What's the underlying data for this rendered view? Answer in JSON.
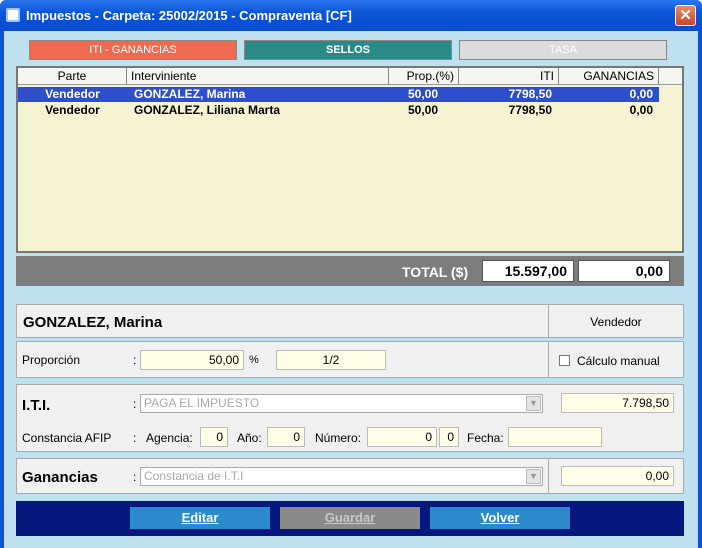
{
  "window": {
    "title": "Impuestos - Carpeta: 25002/2015 - Compraventa [CF]",
    "close_glyph": "✕"
  },
  "tabs": [
    {
      "label": "ITI - GANANCIAS",
      "color": "#f06a50"
    },
    {
      "label": "SELLOS",
      "color": "#2a8b86"
    },
    {
      "label": "TASA",
      "color": "#dcdcdc"
    }
  ],
  "grid": {
    "columns": [
      "Parte",
      "Interviniente",
      "Prop.(%)",
      "ITI",
      "GANANCIAS"
    ],
    "rows": [
      {
        "parte": "Vendedor",
        "interviniente": "GONZALEZ, Marina",
        "prop": "50,00",
        "iti": "7798,50",
        "ganancias": "0,00",
        "selected": true
      },
      {
        "parte": "Vendedor",
        "interviniente": "GONZALEZ, Liliana Marta",
        "prop": "50,00",
        "iti": "7798,50",
        "ganancias": "0,00",
        "selected": false
      }
    ]
  },
  "total": {
    "label": "TOTAL ($)",
    "iti": "15.597,00",
    "ganancias": "0,00"
  },
  "detail": {
    "name": "GONZALEZ, Marina",
    "role": "Vendedor",
    "proporcion_label": "Proporción",
    "colon": ":",
    "proporcion_value": "50,00",
    "percent_sign": "%",
    "fraction": "1/2",
    "manual_label": "Cálculo manual",
    "iti_label": "I.T.I.",
    "iti_combo": "PAGA EL IMPUESTO",
    "iti_value": "7.798,50",
    "constancia_label": "Constancia AFIP",
    "agencia_label": "Agencia:",
    "agencia_value": "0",
    "anio_label": "Año:",
    "anio_value": "0",
    "numero_label": "Número:",
    "numero_value": "0",
    "numero_dv": "0",
    "fecha_label": "Fecha:",
    "fecha_value": "",
    "ganancias_label": "Ganancias",
    "ganancias_combo": "Constancia de I.T.I",
    "ganancias_value": "0,00"
  },
  "buttons": {
    "editar": "Editar",
    "guardar": "Guardar",
    "volver": "Volver"
  }
}
